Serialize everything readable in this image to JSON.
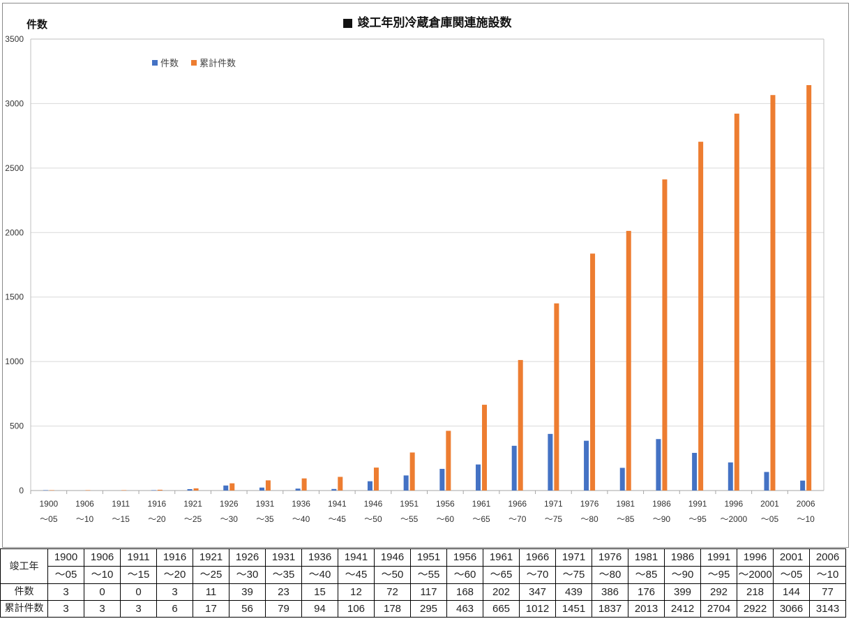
{
  "chart_data": {
    "type": "bar",
    "title": "■ 竣工年別冷蔵倉庫関連施設数",
    "ylabel": "件数",
    "xlabel": "",
    "ylim": [
      0,
      3500
    ],
    "yticks": [
      0,
      500,
      1000,
      1500,
      2000,
      2500,
      3000,
      3500
    ],
    "grid": true,
    "legend_position": "top-left",
    "categories": [
      [
        "1900",
        "〜05"
      ],
      [
        "1906",
        "〜10"
      ],
      [
        "1911",
        "〜15"
      ],
      [
        "1916",
        "〜20"
      ],
      [
        "1921",
        "〜25"
      ],
      [
        "1926",
        "〜30"
      ],
      [
        "1931",
        "〜35"
      ],
      [
        "1936",
        "〜40"
      ],
      [
        "1941",
        "〜45"
      ],
      [
        "1946",
        "〜50"
      ],
      [
        "1951",
        "〜55"
      ],
      [
        "1956",
        "〜60"
      ],
      [
        "1961",
        "〜65"
      ],
      [
        "1966",
        "〜70"
      ],
      [
        "1971",
        "〜75"
      ],
      [
        "1976",
        "〜80"
      ],
      [
        "1981",
        "〜85"
      ],
      [
        "1986",
        "〜90"
      ],
      [
        "1991",
        "〜95"
      ],
      [
        "1996",
        "〜2000"
      ],
      [
        "2001",
        "〜05"
      ],
      [
        "2006",
        "〜10"
      ]
    ],
    "series": [
      {
        "name": "件数",
        "color": "#4472C4",
        "values": [
          3,
          0,
          0,
          3,
          11,
          39,
          23,
          15,
          12,
          72,
          117,
          168,
          202,
          347,
          439,
          386,
          176,
          399,
          292,
          218,
          144,
          77
        ]
      },
      {
        "name": "累計件数",
        "color": "#ED7D31",
        "values": [
          3,
          3,
          3,
          6,
          17,
          56,
          79,
          94,
          106,
          178,
          295,
          463,
          665,
          1012,
          1451,
          1837,
          2013,
          2412,
          2704,
          2922,
          3066,
          3143
        ]
      }
    ]
  },
  "table": {
    "header_label": "竣工年",
    "row1_label": "件数",
    "row2_label": "累計件数"
  }
}
